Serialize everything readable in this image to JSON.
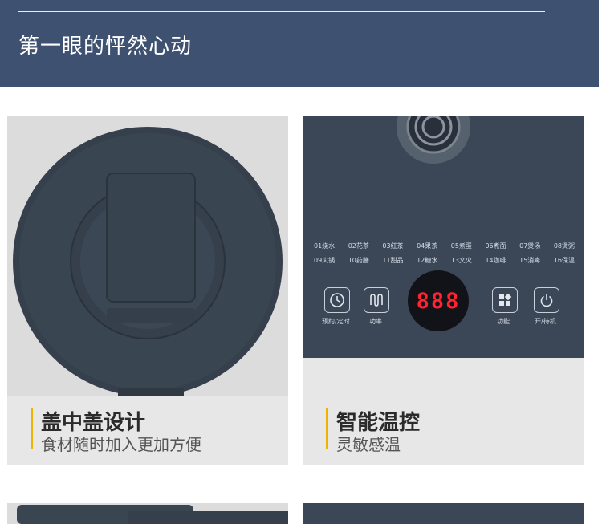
{
  "header": {
    "title": "第一眼的怦然心动"
  },
  "cards": [
    {
      "title": "盖中盖设计",
      "subtitle": "食材随时加入更加方便"
    },
    {
      "title": "智能温控",
      "subtitle": "灵敏感温"
    }
  ],
  "control_panel": {
    "functions_row1": [
      "01烧水",
      "02花茶",
      "03红茶",
      "04果茶",
      "05煮蛋",
      "06煮面",
      "07煲汤",
      "08煲粥"
    ],
    "functions_row2": [
      "09火锅",
      "10药膳",
      "11甜品",
      "12糖水",
      "13文火",
      "14咖啡",
      "15消毒",
      "16保温"
    ],
    "display_value": "888",
    "buttons": [
      {
        "icon": "clock-icon",
        "label": "预约/定时"
      },
      {
        "icon": "heating-coil-icon",
        "label": "功率"
      },
      {
        "icon": "grid-menu-icon",
        "label": "功能"
      },
      {
        "icon": "power-icon",
        "label": "开/待机"
      }
    ]
  },
  "colors": {
    "banner": "#3f5170",
    "panel": "#3b4757",
    "accent": "#f0b400",
    "display_digits": "#ff2430",
    "card_bg": "#e7e7e8"
  }
}
